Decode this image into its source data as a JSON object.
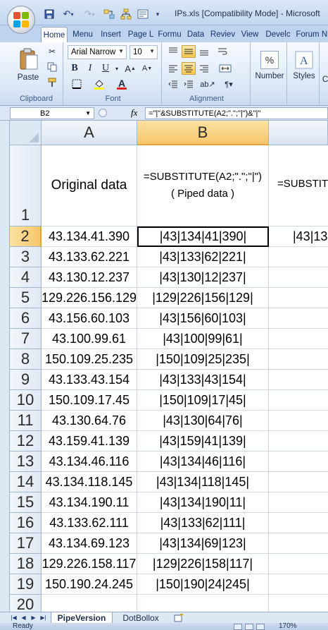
{
  "title_bar": {
    "title": "IPs.xls  [Compatibility Mode] - Microsoft"
  },
  "ribbon": {
    "tabs": [
      "Home",
      "Menu",
      "Insert",
      "Page L",
      "Formu",
      "Data",
      "Reviev",
      "View",
      "Develc",
      "Forum",
      "N"
    ],
    "active_tab": "Home",
    "clipboard": {
      "label": "Clipboard",
      "paste_label": "Paste"
    },
    "font": {
      "label": "Font",
      "font_name": "Arial Narrow",
      "font_size": "10",
      "bold": "B",
      "italic": "I",
      "underline": "U"
    },
    "alignment": {
      "label": "Alignment"
    },
    "number": {
      "label": "Number",
      "symbol": "%"
    },
    "styles": {
      "label": "Styles"
    },
    "cells_partial": "C"
  },
  "formula_bar": {
    "name_box": "B2",
    "fx": "fx",
    "formula": "=\"|\"&SUBSTITUTE(A2;\".\";\"|\")&\"|\""
  },
  "grid": {
    "columns": [
      "A",
      "B"
    ],
    "selected_column": "B",
    "selected_row": "2",
    "header_row": {
      "row": "1",
      "a": "Original data",
      "b_line1": "=SUBSTITUTE(A2;\".\";\"|\")",
      "b_line2": "( Piped data )",
      "c": "=SUBSTIT"
    },
    "c2_partial": "|43|13",
    "rows": [
      {
        "row": "2",
        "a": "43.134.41.390",
        "b": "|43|134|41|390|"
      },
      {
        "row": "3",
        "a": "43.133.62.221",
        "b": "|43|133|62|221|"
      },
      {
        "row": "4",
        "a": "43.130.12.237",
        "b": "|43|130|12|237|"
      },
      {
        "row": "5",
        "a": "129.226.156.129",
        "b": "|129|226|156|129|"
      },
      {
        "row": "6",
        "a": "43.156.60.103",
        "b": "|43|156|60|103|"
      },
      {
        "row": "7",
        "a": "43.100.99.61",
        "b": "|43|100|99|61|"
      },
      {
        "row": "8",
        "a": "150.109.25.235",
        "b": "|150|109|25|235|"
      },
      {
        "row": "9",
        "a": "43.133.43.154",
        "b": "|43|133|43|154|"
      },
      {
        "row": "10",
        "a": "150.109.17.45",
        "b": "|150|109|17|45|"
      },
      {
        "row": "11",
        "a": "43.130.64.76",
        "b": "|43|130|64|76|"
      },
      {
        "row": "12",
        "a": "43.159.41.139",
        "b": "|43|159|41|139|"
      },
      {
        "row": "13",
        "a": "43.134.46.116",
        "b": "|43|134|46|116|"
      },
      {
        "row": "14",
        "a": "43.134.118.145",
        "b": "|43|134|118|145|"
      },
      {
        "row": "15",
        "a": "43.134.190.11",
        "b": "|43|134|190|11|"
      },
      {
        "row": "16",
        "a": "43.133.62.111",
        "b": "|43|133|62|111|"
      },
      {
        "row": "17",
        "a": "43.134.69.123",
        "b": "|43|134|69|123|"
      },
      {
        "row": "18",
        "a": "129.226.158.117",
        "b": "|129|226|158|117|"
      },
      {
        "row": "19",
        "a": "150.190.24.245",
        "b": "|150|190|24|245|"
      }
    ],
    "last_row": "20"
  },
  "sheet_tabs": {
    "tabs": [
      "PipeVersion",
      "DotBollox"
    ],
    "active": "PipeVersion"
  },
  "status_bar": {
    "status": "Ready",
    "zoom": "170%"
  },
  "colors": {
    "selection_header": "#f6c66a",
    "ribbon_blue": "#bfd3ee",
    "grid_line": "#d0d7e5"
  }
}
